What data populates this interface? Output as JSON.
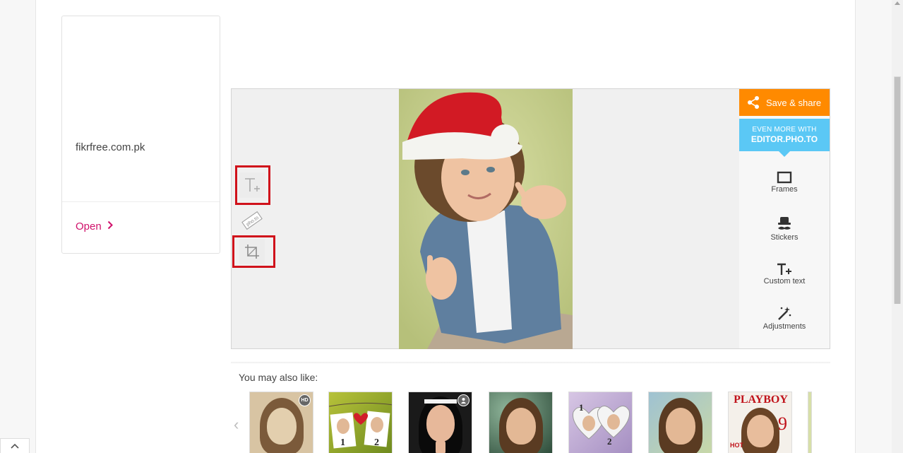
{
  "ad": {
    "domain": "fikrfree.com.pk",
    "open_label": "Open"
  },
  "editor": {
    "tools": {
      "add_text_icon": "text-plus-icon",
      "stamp_text": "pho.to",
      "crop_icon": "crop-icon"
    },
    "sidebar": {
      "save_label": "Save & share",
      "more_line1": "EVEN MORE WITH",
      "more_line2": "EDITOR.PHO.TO",
      "items": [
        {
          "label": "Frames",
          "icon": "frame-icon"
        },
        {
          "label": "Stickers",
          "icon": "hat-mustache-icon"
        },
        {
          "label": "Custom text",
          "icon": "text-plus-icon"
        },
        {
          "label": "Adjustments",
          "icon": "magic-wand-icon"
        }
      ]
    },
    "colors": {
      "save": "#ff8a00",
      "more": "#5bc8f5",
      "highlight": "#d0121b"
    }
  },
  "also_like": {
    "title": "You may also like:",
    "prev_arrow": "‹",
    "thumbnails": [
      {
        "name": "sepia-portrait",
        "badge": "HD"
      },
      {
        "name": "clothespin-photos",
        "numbers": [
          "1",
          "2"
        ]
      },
      {
        "name": "nun-portrait",
        "badge_icon": "person-icon"
      },
      {
        "name": "bokeh-portrait"
      },
      {
        "name": "heart-frames",
        "numbers": [
          "1",
          "2"
        ]
      },
      {
        "name": "rain-glass-portrait"
      },
      {
        "name": "magazine-cover",
        "masthead": "PLAYBOY",
        "issue": "9",
        "corner": "HOT"
      }
    ]
  }
}
